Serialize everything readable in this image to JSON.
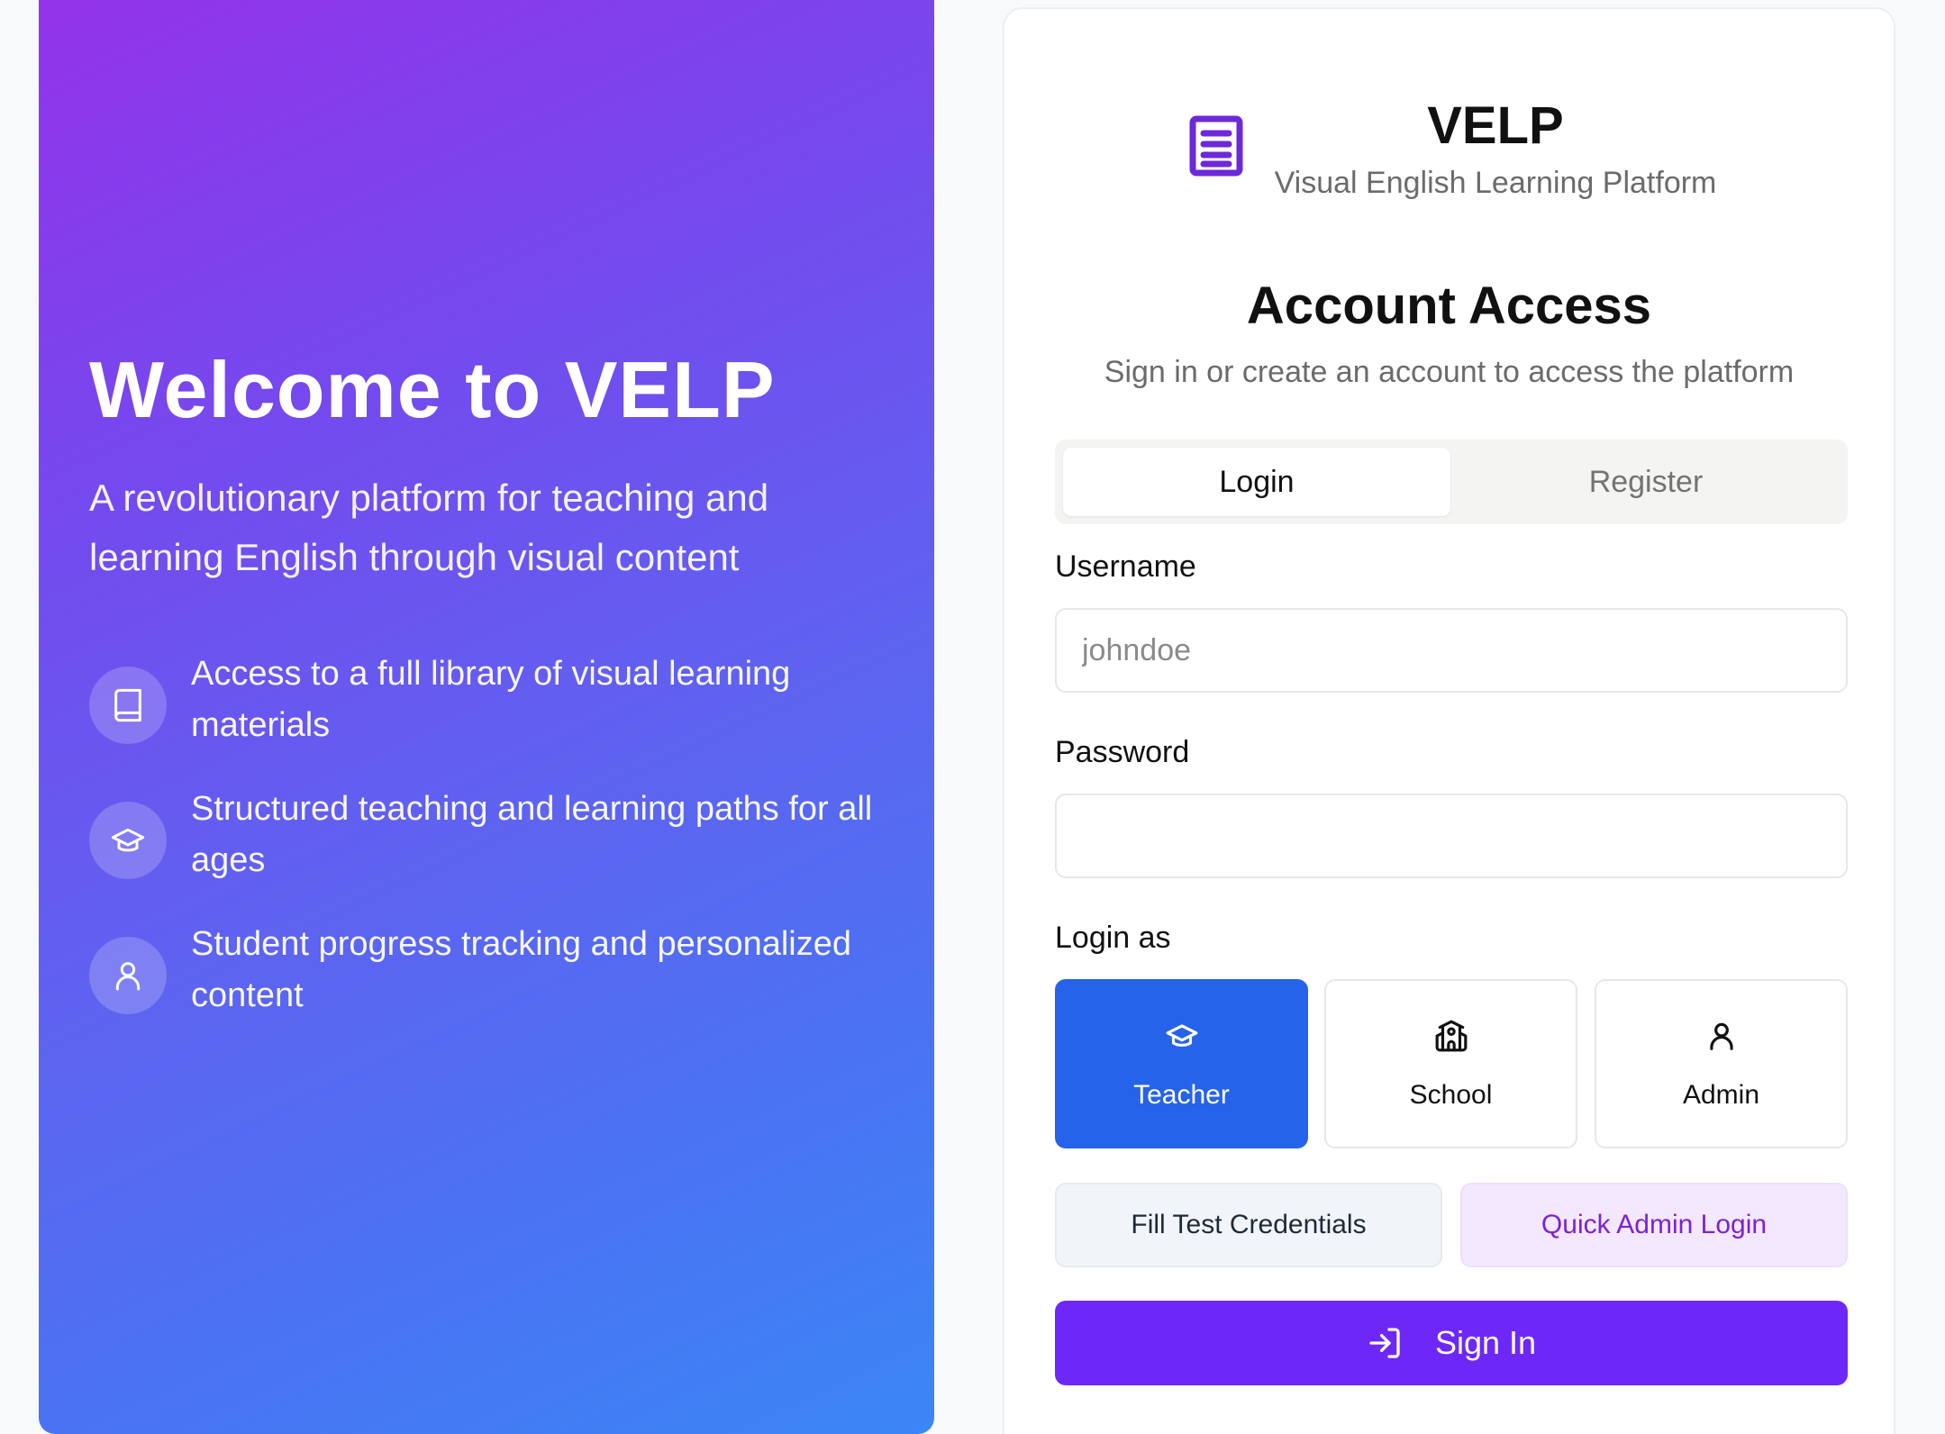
{
  "hero": {
    "title": "Welcome to VELP",
    "subtitle": "A revolutionary platform for teaching and learning English through visual content",
    "features": [
      {
        "icon": "book-icon",
        "text": "Access to a full library of visual learning materials"
      },
      {
        "icon": "graduation-cap-icon",
        "text": "Structured teaching and learning paths for all ages"
      },
      {
        "icon": "user-icon",
        "text": "Student progress tracking and personalized content"
      }
    ],
    "gradient_start": "#9333ea",
    "gradient_end": "#3b86f6"
  },
  "brand": {
    "icon": "document-icon",
    "name": "VELP",
    "tagline": "Visual English Learning Platform",
    "accent": "#6d28d9"
  },
  "auth": {
    "title": "Account Access",
    "subtitle": "Sign in or create an account to access the platform",
    "tabs": {
      "login": "Login",
      "register": "Register",
      "active": "Login"
    },
    "username": {
      "label": "Username",
      "placeholder": "johndoe",
      "value": ""
    },
    "password": {
      "label": "Password",
      "value": ""
    },
    "login_as": {
      "label": "Login as",
      "options": [
        {
          "icon": "graduation-cap-icon",
          "label": "Teacher",
          "selected": true
        },
        {
          "icon": "school-icon",
          "label": "School",
          "selected": false
        },
        {
          "icon": "user-icon",
          "label": "Admin",
          "selected": false
        }
      ],
      "selected_color": "#2563eb"
    },
    "fill_test_label": "Fill Test Credentials",
    "quick_admin_label": "Quick Admin Login",
    "sign_in": {
      "icon": "log-in-icon",
      "label": "Sign In",
      "color": "#6d28f7"
    }
  }
}
